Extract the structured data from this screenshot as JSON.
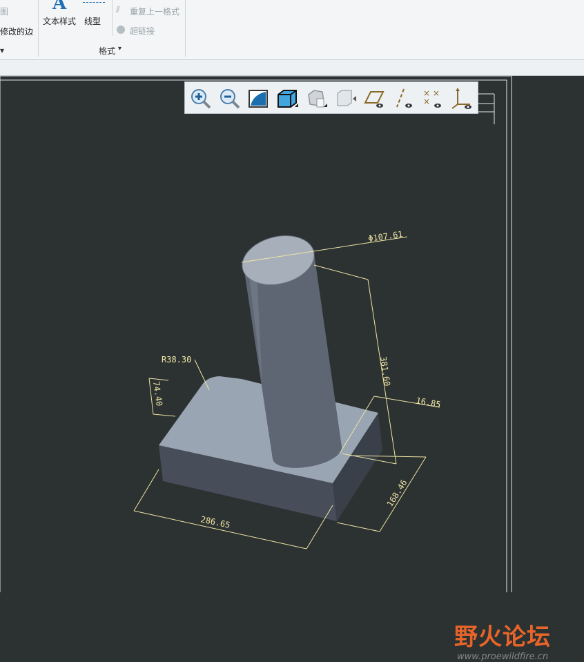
{
  "ribbon": {
    "left_item_1": "图",
    "left_item_2": "修改的边",
    "text_style_label": "文本样式",
    "line_type_label": "线型",
    "repeat_format_label": "重复上一格式",
    "hyperlink_label": "超链接",
    "format_group_label": "格式",
    "text_style_icon_glyph": "A"
  },
  "view_toolbar": {
    "icons": [
      "zoom-in-icon",
      "zoom-out-icon",
      "refit-icon",
      "display-style-icon",
      "saved-orientations-icon",
      "view-manager-icon",
      "datum-plane-display-icon",
      "datum-axis-display-icon",
      "datum-point-display-icon",
      "coordinate-system-display-icon"
    ]
  },
  "dimensions": {
    "diameter": "Φ107.61",
    "height": "381.60",
    "radius": "R38.30",
    "side": "74.40",
    "thickness": "16.85",
    "length": "286.65",
    "width": "168.46"
  },
  "watermark": {
    "title": "野火论坛",
    "url": "www.proewildfire.cn"
  },
  "colors": {
    "viewport_bg": "#2c3132",
    "dimension_line": "#efe6a4",
    "part_top": "#9aa5b3",
    "part_side": "#535a67",
    "watermark": "#e8652a"
  }
}
